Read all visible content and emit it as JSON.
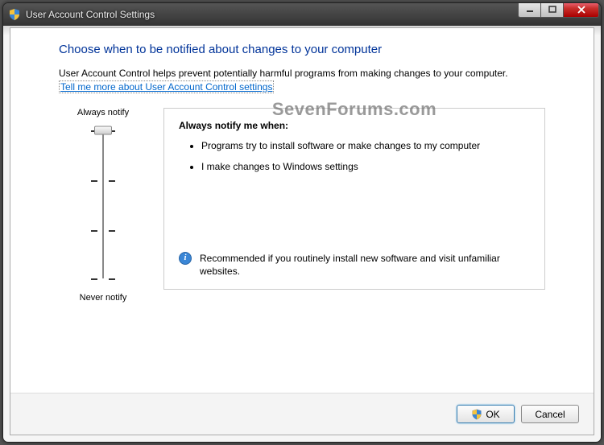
{
  "window": {
    "title": "User Account Control Settings"
  },
  "page": {
    "heading": "Choose when to be notified about changes to your computer",
    "intro": "User Account Control helps prevent potentially harmful programs from making changes to your computer.",
    "help_link": "Tell me more about User Account Control settings"
  },
  "slider": {
    "top_label": "Always notify",
    "bottom_label": "Never notify",
    "levels": 4,
    "current_level": 0
  },
  "detail": {
    "heading": "Always notify me when:",
    "bullets": [
      "Programs try to install software or make changes to my computer",
      "I make changes to Windows settings"
    ],
    "recommend": "Recommended if you routinely install new software and visit unfamiliar websites."
  },
  "buttons": {
    "ok": "OK",
    "cancel": "Cancel"
  },
  "watermark": "SevenForums.com"
}
